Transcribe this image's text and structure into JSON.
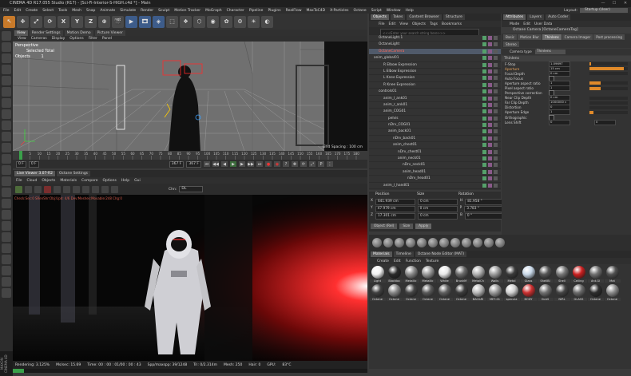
{
  "window": {
    "title": "CINEMA 4D R17.055 Studio (R17) - [Sci-Fi-Interior-S-HIGH.c4d *] - Main",
    "controls": [
      "—",
      "☐",
      "✕"
    ]
  },
  "menubar": {
    "items": [
      "File",
      "Edit",
      "Create",
      "Select",
      "Tools",
      "Mesh",
      "Snap",
      "Animate",
      "Simulate",
      "Render",
      "Sculpt",
      "Motion Tracker",
      "MoGraph",
      "Character",
      "Pipeline",
      "Plugins",
      "RealFlow",
      "MaxToC4D",
      "X-Particles",
      "Octane",
      "Script",
      "Window",
      "Help"
    ],
    "layout_label": "Layout:",
    "layout_value": "Startup (User)"
  },
  "toolbar": {
    "buttons": [
      "↖",
      "✥",
      "⤢",
      "⟳",
      "X",
      "Y",
      "Z",
      "⊕",
      "🎬",
      "▶",
      "🎞",
      "◈",
      "⬚",
      "❖",
      "⬡",
      "◉",
      "✿",
      "⚙",
      "☀",
      "◐"
    ]
  },
  "viewport": {
    "tabs": [
      "View",
      "Render Settings",
      "Motion Demo",
      "Picture Viewer"
    ],
    "menu": [
      "View",
      "Cameras",
      "Display",
      "Options",
      "Filter",
      "Panel"
    ],
    "label": "Perspective",
    "selected_total": "Selected Total",
    "objects_label": "Objects",
    "objects_count": "1",
    "grid_spacing": "Grid Spacing : 100 cm"
  },
  "timeline": {
    "ticks": [
      "0",
      "5",
      "10",
      "15",
      "20",
      "25",
      "30",
      "35",
      "40",
      "45",
      "50",
      "55",
      "60",
      "65",
      "70",
      "75",
      "80",
      "85",
      "90",
      "95",
      "100",
      "105",
      "110",
      "115",
      "120",
      "125",
      "130",
      "135",
      "140",
      "145",
      "150",
      "155",
      "160",
      "165",
      "170",
      "175",
      "180"
    ],
    "current_frame_field": "0 F",
    "start_field": "0 F",
    "end_field": "367 F",
    "end_field2": "367 F",
    "current_indicator": "0 F"
  },
  "live_viewer": {
    "tabs": [
      "Live Viewer 3.07-R2",
      "Octane Settings"
    ],
    "menu": [
      "File",
      "Cloud",
      "Objects",
      "Materials",
      "Compare",
      "Options",
      "Help",
      "Gui"
    ],
    "chn_label": "Chn:",
    "chn_value": "DL",
    "status_line": "Check:Sec:0 SRenShr:Obj:Upd: 4/6 Dev:Meshes:Movable:248 Chg:0",
    "statusbar": {
      "rendering": "Rendering: 3.125%",
      "ms": "Ms/sec: 15.69",
      "time": "Time: 00 : 00 : 01/00 : 00 : 43",
      "spp": "Spp/maxspp: 39/1248",
      "tri": "Tri: 0/2.314m",
      "mesh": "Mesh: 250",
      "hair": "Hair: 0",
      "gpu": "GPU:",
      "temp": "83°C"
    },
    "progress": 3.125
  },
  "maxon_logo": "MAXON CINEMA 4D",
  "object_manager": {
    "tabs": [
      "Objects",
      "Takes",
      "Content Browser",
      "Structure"
    ],
    "menu": [
      "File",
      "Edit",
      "View",
      "Objects",
      "Tags",
      "Bookmarks"
    ],
    "search_placeholder": "<<<Enter your search string here>>>",
    "objects": [
      {
        "name": "OctaneLight.1",
        "indent": 1,
        "red": false,
        "sel": false
      },
      {
        "name": "OctaneLight",
        "indent": 1,
        "red": false,
        "sel": false
      },
      {
        "name": "OctaneCamera",
        "indent": 1,
        "red": true,
        "sel": true
      },
      {
        "name": "anim_global01",
        "indent": 0,
        "red": false,
        "sel": false
      },
      {
        "name": "R Elbow Expression",
        "indent": 2,
        "red": false,
        "sel": false
      },
      {
        "name": "L Elbow Expression",
        "indent": 2,
        "red": false,
        "sel": false
      },
      {
        "name": "L Knee Expression",
        "indent": 2,
        "red": false,
        "sel": false
      },
      {
        "name": "R Knee Expression",
        "indent": 2,
        "red": false,
        "sel": false
      },
      {
        "name": "controls01",
        "indent": 1,
        "red": false,
        "sel": false
      },
      {
        "name": "anim_l_ank01",
        "indent": 2,
        "red": false,
        "sel": false
      },
      {
        "name": "anim_r_ank01",
        "indent": 2,
        "red": false,
        "sel": false
      },
      {
        "name": "anim_COG01",
        "indent": 2,
        "red": false,
        "sel": false
      },
      {
        "name": "pelvis",
        "indent": 3,
        "red": false,
        "sel": false
      },
      {
        "name": "nDrv_COG01",
        "indent": 3,
        "red": false,
        "sel": false
      },
      {
        "name": "anim_back01",
        "indent": 3,
        "red": false,
        "sel": false
      },
      {
        "name": "nDrv_back01",
        "indent": 4,
        "red": false,
        "sel": false
      },
      {
        "name": "anim_chest01",
        "indent": 4,
        "red": false,
        "sel": false
      },
      {
        "name": "nDrv_chest01",
        "indent": 5,
        "red": false,
        "sel": false
      },
      {
        "name": "anim_neck01",
        "indent": 5,
        "red": false,
        "sel": false
      },
      {
        "name": "nDrv_neck01",
        "indent": 6,
        "red": false,
        "sel": false
      },
      {
        "name": "anim_head01",
        "indent": 6,
        "red": false,
        "sel": false
      },
      {
        "name": "nDrv_head01",
        "indent": 7,
        "red": false,
        "sel": false
      },
      {
        "name": "anim_l_hand01",
        "indent": 2,
        "red": false,
        "sel": false
      }
    ]
  },
  "coordinates": {
    "headers": [
      "Position",
      "Size",
      "Rotation"
    ],
    "rows": [
      {
        "axis": "X",
        "pos": "641.939 cm",
        "size": "0 cm",
        "rot_axis": "H",
        "rot": "81.958 °"
      },
      {
        "axis": "Y",
        "pos": "47.979 cm",
        "size": "0 cm",
        "rot_axis": "P",
        "rot": "3.783 °"
      },
      {
        "axis": "Z",
        "pos": "17.301 cm",
        "size": "0 cm",
        "rot_axis": "B",
        "rot": "0 °"
      }
    ],
    "mode": "Object (Rel)",
    "size_mode": "Size",
    "apply": "Apply"
  },
  "materials": {
    "tabs": [
      "Materials",
      "Timeline",
      "Octane Node Editor (MAT)"
    ],
    "menu": [
      "Create",
      "Edit",
      "Function",
      "Texture"
    ],
    "items": [
      {
        "label": "Light",
        "color": "#f2f2f2"
      },
      {
        "label": "Blackbo",
        "color": "#2a2a2a"
      },
      {
        "label": "Metallic",
        "color": "#8a8a8a"
      },
      {
        "label": "Metallic",
        "color": "#9a9a9a"
      },
      {
        "label": "White",
        "color": "#e8e8e8"
      },
      {
        "label": "BrushM",
        "color": "#6a6a6a"
      },
      {
        "label": "MetalCh",
        "color": "#b0b0b0"
      },
      {
        "label": "Walls",
        "color": "#9c9c9c"
      },
      {
        "label": "Metal",
        "color": "#3a3a3a"
      },
      {
        "label": "Glass",
        "color": "#c8d8e8"
      },
      {
        "label": "ShellBl",
        "color": "#555555"
      },
      {
        "label": "Shell",
        "color": "#777777"
      },
      {
        "label": "Ceiling",
        "color": "#cc2020"
      },
      {
        "label": "Ant.Gl",
        "color": "#707070"
      },
      {
        "label": "Mat",
        "color": "#505050"
      },
      {
        "label": "Octane",
        "color": "#404040"
      },
      {
        "label": "Octane",
        "color": "#888888"
      },
      {
        "label": "Octane",
        "color": "#454545"
      },
      {
        "label": "Octane",
        "color": "#5a5a5a"
      },
      {
        "label": "Octane",
        "color": "#606060"
      },
      {
        "label": "Octane",
        "color": "#3c3c3c"
      },
      {
        "label": "BAC&RI",
        "color": "#b8b8b8"
      },
      {
        "label": "MET-01",
        "color": "#9a9a9a"
      },
      {
        "label": "specula",
        "color": "#d0d0d0"
      },
      {
        "label": "BODY",
        "color": "#cc3030"
      },
      {
        "label": "GLAS",
        "color": "#707070"
      },
      {
        "label": "NIRL",
        "color": "#444444"
      },
      {
        "label": "GLASS",
        "color": "#6a6a6a"
      },
      {
        "label": "Octane",
        "color": "#2d2d2d"
      },
      {
        "label": "Octane",
        "color": "#8c8c8c"
      }
    ]
  },
  "attributes": {
    "tabs": [
      "Attributes",
      "Layers",
      "Auto Coder"
    ],
    "menu": [
      "Mode",
      "Edit",
      "User Data"
    ],
    "title": "Octane Camera [OctaneCameraTag]",
    "subtabs": [
      "Basic",
      "Motion Blur",
      "Thinlens",
      "Camera Imager",
      "Post processing",
      "Stereo"
    ],
    "active_subtab": "Thinlens",
    "camera_type_label": "Camera type",
    "camera_type_value": "Thinlens",
    "section": "Thinlens",
    "rows": [
      {
        "label": "F-Stop",
        "value": "1.09697",
        "slider": 0.05,
        "orange": false
      },
      {
        "label": "Aperture",
        "value": "15 cm",
        "slider": 0.9,
        "orange": true
      },
      {
        "label": "Focal Depth",
        "value": "0 cm",
        "slider": 0,
        "orange": false
      },
      {
        "label": "Auto Focus",
        "value": "",
        "slider": null,
        "orange": false
      },
      {
        "label": "Aperture aspect ratio",
        "value": "1",
        "slider": 0.3,
        "orange": false
      },
      {
        "label": "Pixel aspect ratio",
        "value": "1",
        "slider": 0.3,
        "orange": false
      },
      {
        "label": "Perspective correction",
        "value": "",
        "slider": null,
        "orange": false
      },
      {
        "label": "Near Clip Depth",
        "value": "0 cm",
        "slider": 0,
        "orange": false
      },
      {
        "label": "Far Clip Depth",
        "value": "1000000 c",
        "slider": 0,
        "orange": false
      },
      {
        "label": "Distortion",
        "value": "0",
        "slider": 0,
        "orange": false
      },
      {
        "label": "Aperture Edge",
        "value": "1",
        "slider": 0.1,
        "orange": false
      },
      {
        "label": "Orthographic",
        "value": "",
        "slider": null,
        "orange": false
      },
      {
        "label": "Lens Shift",
        "value": "0",
        "value2": "0",
        "slider": null,
        "orange": false
      }
    ]
  }
}
